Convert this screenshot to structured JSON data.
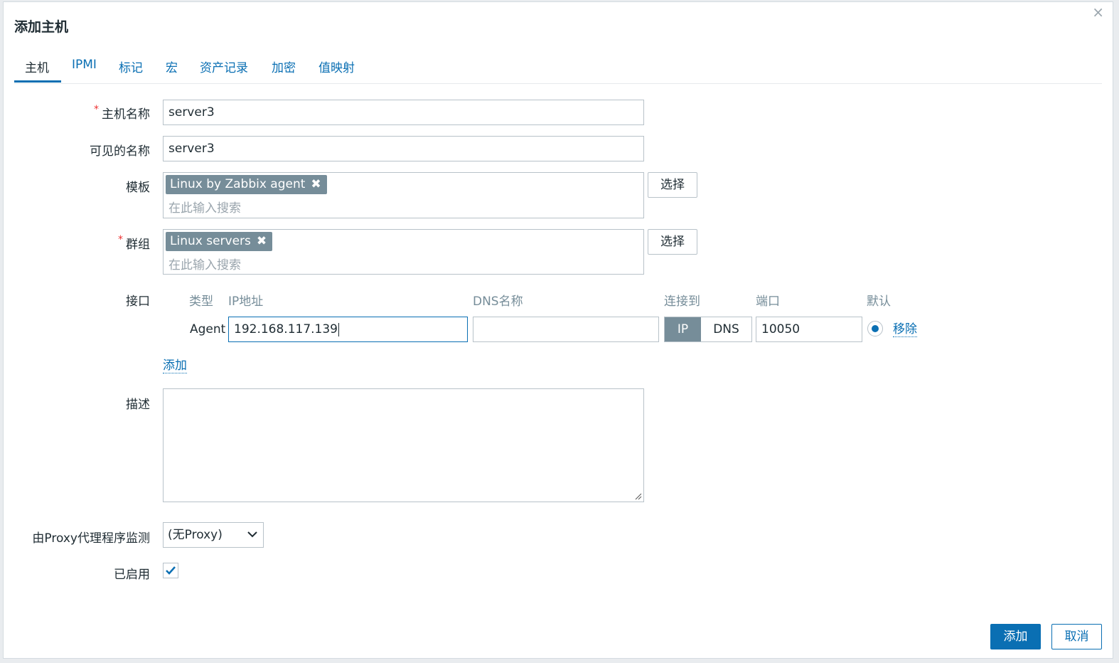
{
  "dialog": {
    "title": "添加主机",
    "close_label": "×"
  },
  "tabs": [
    {
      "label": "主机"
    },
    {
      "label": "IPMI"
    },
    {
      "label": "标记"
    },
    {
      "label": "宏"
    },
    {
      "label": "资产记录"
    },
    {
      "label": "加密"
    },
    {
      "label": "值映射"
    }
  ],
  "form": {
    "host_name": {
      "label": "主机名称",
      "required_mark": "*",
      "value": "server3"
    },
    "visible_name": {
      "label": "可见的名称",
      "value": "server3"
    },
    "templates": {
      "label": "模板",
      "chips": [
        "Linux by Zabbix agent"
      ],
      "placeholder": "在此输入搜索",
      "select_button": "选择"
    },
    "groups": {
      "label": "群组",
      "required_mark": "*",
      "chips": [
        "Linux servers"
      ],
      "placeholder": "在此输入搜索",
      "select_button": "选择"
    },
    "interfaces": {
      "label": "接口",
      "headers": {
        "type": "类型",
        "ip": "IP地址",
        "dns": "DNS名称",
        "connect": "连接到",
        "port": "端口",
        "default": "默认"
      },
      "rows": [
        {
          "type": "Agent",
          "ip": "192.168.117.139",
          "dns": "",
          "connect_ip": "IP",
          "connect_dns": "DNS",
          "connect_selected": "IP",
          "port": "10050",
          "default": true,
          "remove_label": "移除"
        }
      ],
      "add_label": "添加"
    },
    "description": {
      "label": "描述",
      "value": ""
    },
    "proxy": {
      "label": "由Proxy代理程序监测",
      "selected": "(无Proxy)"
    },
    "enabled": {
      "label": "已启用",
      "checked": true
    }
  },
  "footer": {
    "add_button": "添加",
    "cancel_button": "取消"
  },
  "colors": {
    "accent": "#0a6fb3",
    "chip": "#768d99",
    "required": "#e33333"
  },
  "icons": {
    "chip_remove": "close-icon",
    "select_arrow": "chevron-down-icon",
    "check": "check-icon",
    "textarea_resize": "resize-handle-icon"
  }
}
